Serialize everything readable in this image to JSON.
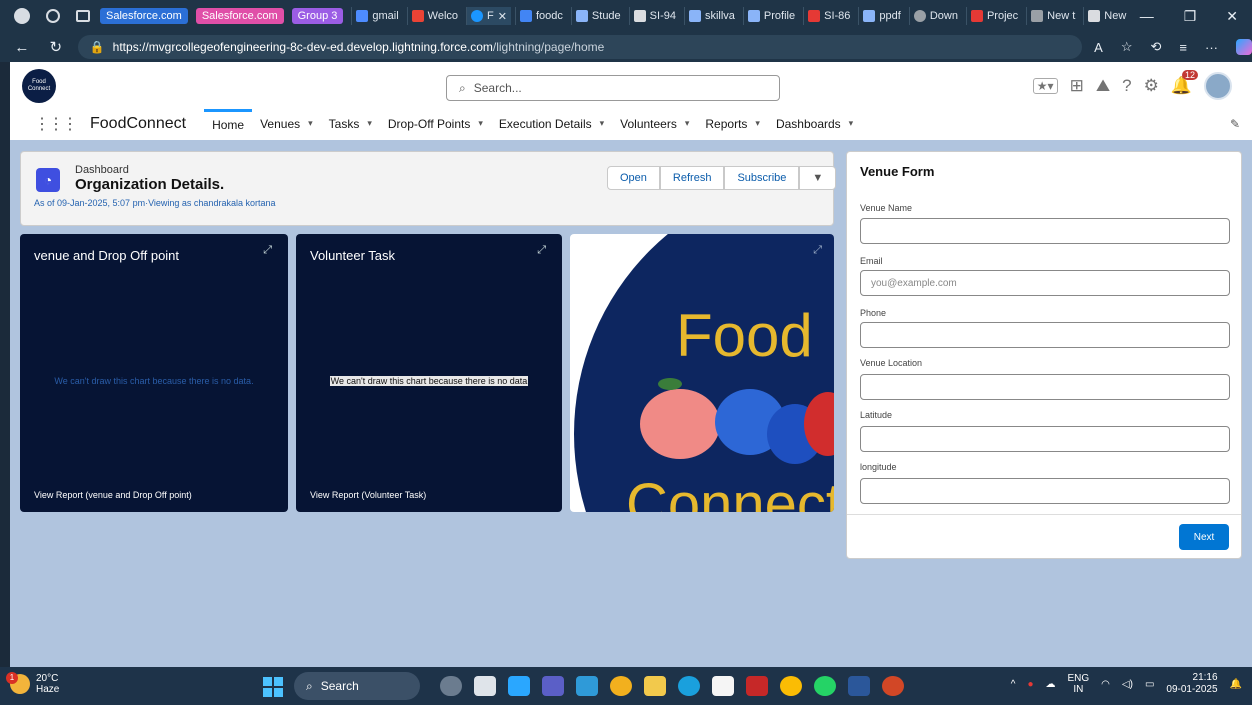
{
  "browser": {
    "tab_groups": [
      {
        "label": "Salesforce.com",
        "color": "#2b6fd6"
      },
      {
        "label": "Salesforce.com",
        "color": "#e04fa8"
      },
      {
        "label": "Group 3",
        "color": "#9b5de5"
      }
    ],
    "tabs": [
      {
        "label": "gmail",
        "color": "#4e8cff"
      },
      {
        "label": "Welco",
        "color": "#ea4335"
      },
      {
        "label": "F",
        "color": "#1b96ff",
        "active": true
      },
      {
        "label": "foodc",
        "color": "#4285f4"
      },
      {
        "label": "Stude",
        "color": "#8ab4f8"
      },
      {
        "label": "SI-94",
        "color": "#dadce0"
      },
      {
        "label": "skillva",
        "color": "#8ab4f8"
      },
      {
        "label": "Profile",
        "color": "#8ab4f8"
      },
      {
        "label": "SI-86",
        "color": "#e53935"
      },
      {
        "label": "ppdf",
        "color": "#8ab4f8"
      },
      {
        "label": "Down",
        "color": "#9aa0a6"
      },
      {
        "label": "Projec",
        "color": "#e53935"
      },
      {
        "label": "New t",
        "color": "#9aa0a6"
      },
      {
        "label": "New",
        "color": "#dadce0"
      }
    ],
    "url_host": "https://mvgrcollegeofengineering-8c-dev-ed.develop.lightning.force.com",
    "url_path": "/lightning/page/home"
  },
  "header": {
    "logo_text": "Food Connect",
    "search_placeholder": "Search...",
    "notification_count": "12"
  },
  "nav": {
    "app_name": "FoodConnect",
    "items": [
      {
        "label": "Home",
        "active": true,
        "dropdown": false
      },
      {
        "label": "Venues",
        "dropdown": true
      },
      {
        "label": "Tasks",
        "dropdown": true
      },
      {
        "label": "Drop-Off Points",
        "dropdown": true
      },
      {
        "label": "Execution Details",
        "dropdown": true
      },
      {
        "label": "Volunteers",
        "dropdown": true
      },
      {
        "label": "Reports",
        "dropdown": true
      },
      {
        "label": "Dashboards",
        "dropdown": true
      }
    ]
  },
  "dashboard": {
    "label": "Dashboard",
    "title": "Organization Details.",
    "subtitle": "As of 09-Jan-2025, 5:07 pm·Viewing as chandrakala kortana",
    "buttons": {
      "open": "Open",
      "refresh": "Refresh",
      "subscribe": "Subscribe"
    }
  },
  "widgets": [
    {
      "title": "venue and Drop Off point",
      "message": "We can't draw this chart because there is no data.",
      "footer": "View Report (venue and Drop Off point)"
    },
    {
      "title": "Volunteer Task",
      "message": "We can't draw this chart because there is no data",
      "footer": "View Report (Volunteer Task)"
    }
  ],
  "image_widget": {
    "text_top": "Food",
    "text_bottom": "Connect"
  },
  "venue_form": {
    "title": "Venue Form",
    "fields": [
      {
        "label": "Venue Name",
        "placeholder": ""
      },
      {
        "label": "Email",
        "placeholder": "you@example.com"
      },
      {
        "label": "Phone",
        "placeholder": ""
      },
      {
        "label": "Venue Location",
        "placeholder": ""
      },
      {
        "label": "Latitude",
        "placeholder": ""
      },
      {
        "label": "longitude",
        "placeholder": ""
      }
    ],
    "next_label": "Next"
  },
  "taskbar": {
    "weather_badge": "1",
    "weather_temp": "20°C",
    "weather_desc": "Haze",
    "search_label": "Search",
    "lang_top": "ENG",
    "lang_bottom": "IN",
    "time": "21:16",
    "date": "09-01-2025"
  }
}
